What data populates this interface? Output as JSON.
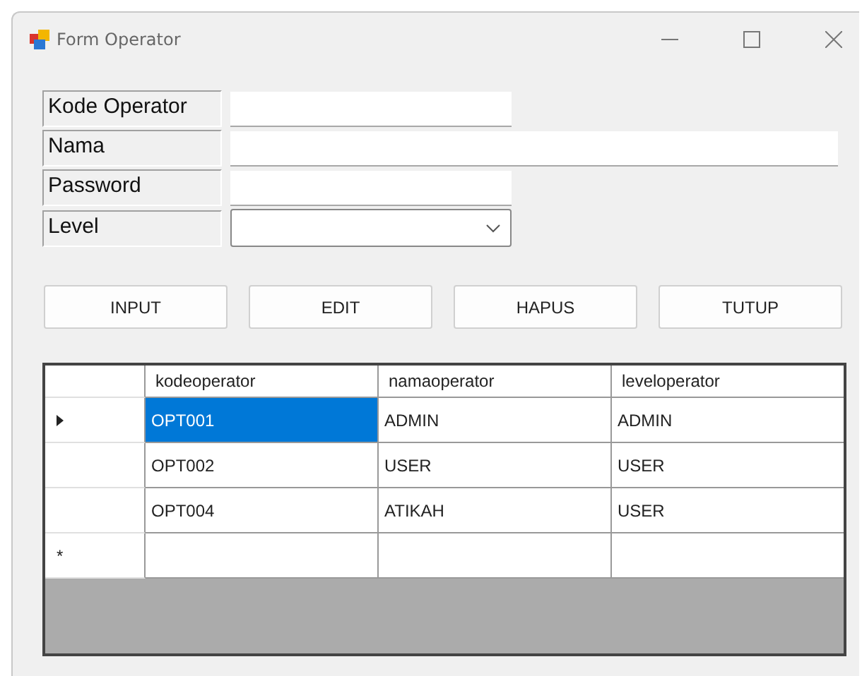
{
  "window": {
    "title": "Form Operator"
  },
  "fields": [
    {
      "label": "Kode Operator",
      "kind": "text"
    },
    {
      "label": "Nama",
      "kind": "text"
    },
    {
      "label": "Password",
      "kind": "text"
    },
    {
      "label": "Level",
      "kind": "dropdown"
    }
  ],
  "buttons": [
    "INPUT",
    "EDIT",
    "HAPUS",
    "TUTUP"
  ],
  "table": {
    "columns": [
      "kodeoperator",
      "namaoperator",
      "leveloperator"
    ],
    "rows": [
      {
        "current": true,
        "cells": [
          {
            "text": "OPT001",
            "selected": true
          },
          {
            "text": "ADMIN",
            "selected": false
          },
          {
            "text": "ADMIN",
            "selected": false
          }
        ]
      },
      {
        "current": false,
        "cells": [
          {
            "text": "OPT002",
            "selected": false
          },
          {
            "text": "USER",
            "selected": false
          },
          {
            "text": "USER",
            "selected": false
          }
        ]
      },
      {
        "current": false,
        "cells": [
          {
            "text": "OPT004",
            "selected": false
          },
          {
            "text": "ATIKAH",
            "selected": false
          },
          {
            "text": "USER",
            "selected": false
          }
        ]
      }
    ],
    "new_row_marker": "*"
  }
}
